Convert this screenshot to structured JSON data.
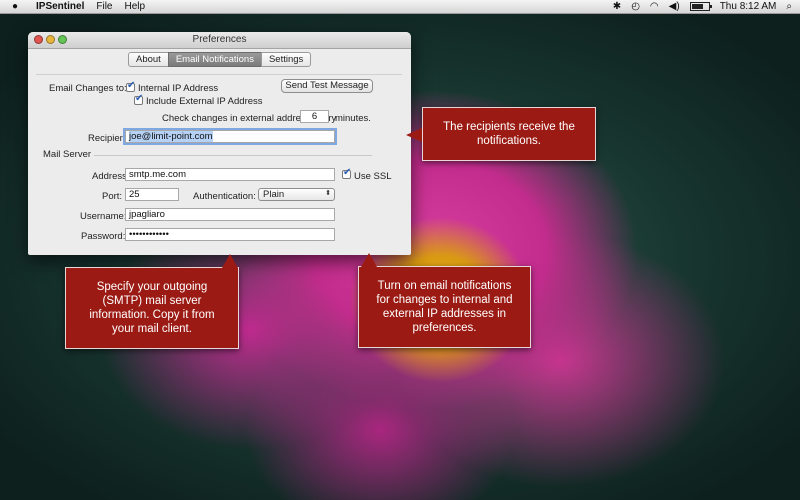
{
  "menubar": {
    "apple": "",
    "app_name": "IPSentinel",
    "items": [
      "File",
      "Help"
    ],
    "clock": "Thu 8:12 AM",
    "battery_level": 0.8
  },
  "window": {
    "title": "Preferences",
    "tabs": [
      "About",
      "Email Notifications",
      "Settings"
    ],
    "active_tab": "Email Notifications"
  },
  "email": {
    "changes_label": "Email Changes to:",
    "internal_ip_label": "Internal IP Address",
    "internal_ip_checked": true,
    "external_ip_label": "Include External IP Address",
    "external_ip_checked": true,
    "send_test_label": "Send Test Message",
    "check_prefix": "Check changes in external address every",
    "check_value": "6",
    "check_suffix": "minutes.",
    "recipient_label": "Recipient:",
    "recipient_value": "joe@limit-point.com"
  },
  "server": {
    "section_label": "Mail Server",
    "address_label": "Address:",
    "address_value": "smtp.me.com",
    "ssl_label": "Use SSL",
    "ssl_checked": true,
    "port_label": "Port:",
    "port_value": "25",
    "auth_label": "Authentication:",
    "auth_value": "Plain",
    "username_label": "Username:",
    "username_value": "jpagliaro",
    "password_label": "Password:",
    "password_value": "••••••••••••"
  },
  "callouts": {
    "recipients": "The recipients receive the notifications.",
    "smtp": "Specify your outgoing (SMTP) mail server information. Copy it from your mail client.",
    "turn_on": "Turn on email notifications for changes to internal and external IP addresses in preferences."
  },
  "colors": {
    "callout_bg": "#9b1b14",
    "accent": "#2a5cb3"
  }
}
